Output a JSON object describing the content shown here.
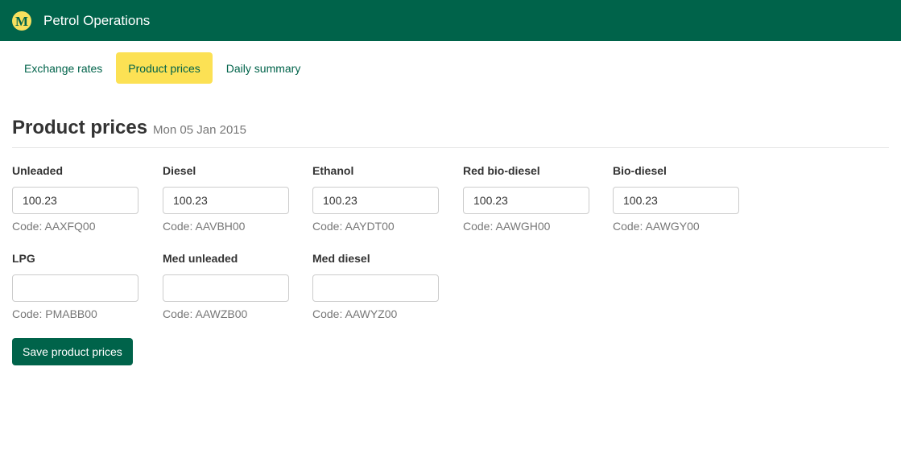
{
  "app": {
    "logo_letter": "M",
    "title": "Petrol Operations",
    "brand_color": "#00634a",
    "accent_color": "#fce154"
  },
  "tabs": [
    {
      "label": "Exchange rates",
      "active": false
    },
    {
      "label": "Product prices",
      "active": true
    },
    {
      "label": "Daily summary",
      "active": false
    }
  ],
  "page": {
    "title": "Product prices",
    "date": "Mon 05 Jan 2015"
  },
  "products": [
    {
      "label": "Unleaded",
      "value": "100.23",
      "code": "Code: AAXFQ00"
    },
    {
      "label": "Diesel",
      "value": "100.23",
      "code": "Code: AAVBH00"
    },
    {
      "label": "Ethanol",
      "value": "100.23",
      "code": "Code: AAYDT00"
    },
    {
      "label": "Red bio-diesel",
      "value": "100.23",
      "code": "Code: AAWGH00"
    },
    {
      "label": "Bio-diesel",
      "value": "100.23",
      "code": "Code: AAWGY00"
    },
    {
      "label": "LPG",
      "value": "",
      "code": "Code: PMABB00"
    },
    {
      "label": "Med unleaded",
      "value": "",
      "code": "Code: AAWZB00"
    },
    {
      "label": "Med diesel",
      "value": "",
      "code": "Code: AAWYZ00"
    }
  ],
  "actions": {
    "save_label": "Save product prices"
  }
}
